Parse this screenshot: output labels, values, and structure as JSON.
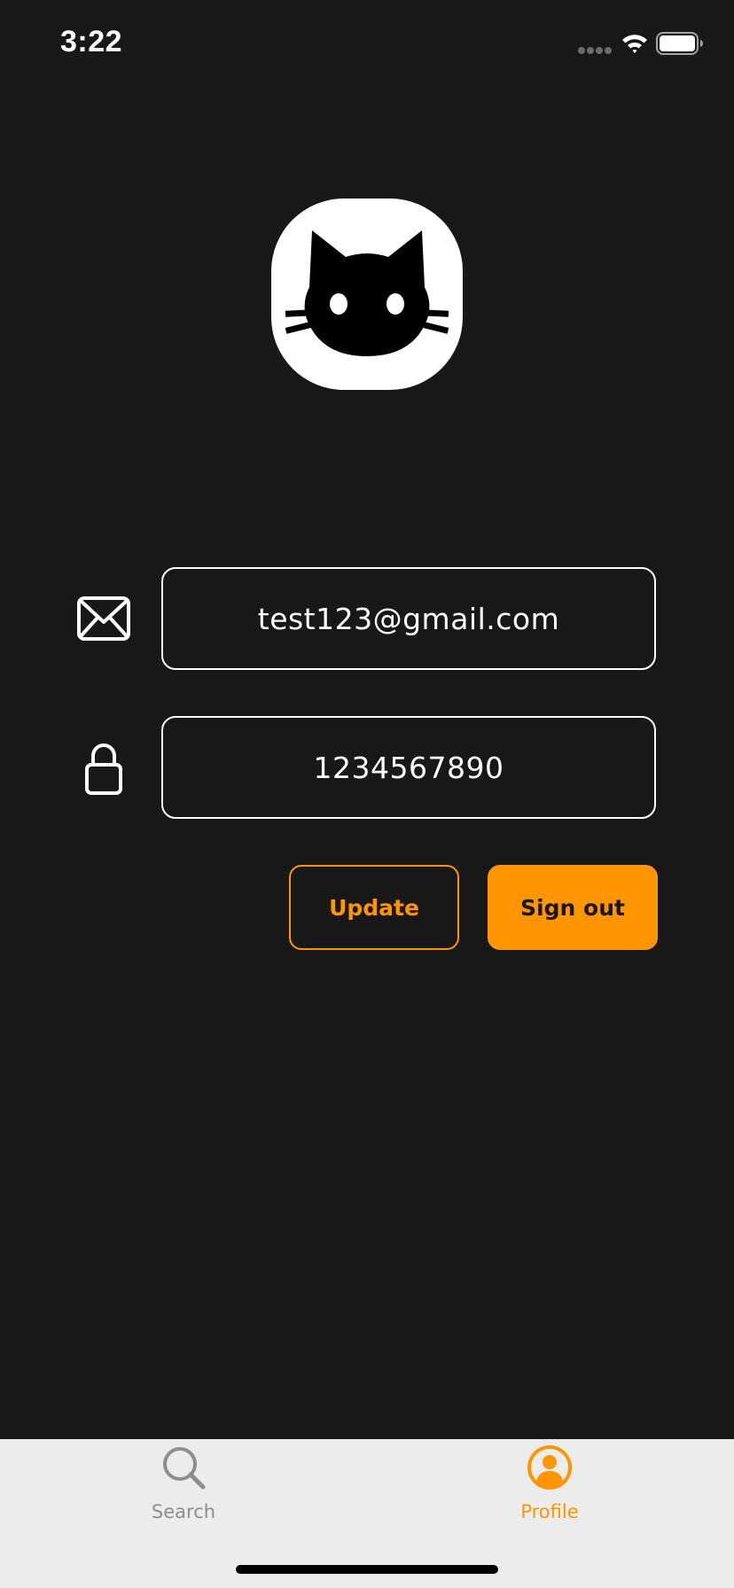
{
  "status_bar": {
    "time": "3:22",
    "icons": [
      "cellular-signal-icon",
      "wifi-icon",
      "battery-icon"
    ]
  },
  "logo": {
    "icon": "cat-icon",
    "background_color": "#ffffff"
  },
  "form": {
    "email": {
      "icon": "envelope-icon",
      "value": "test123@gmail.com"
    },
    "password": {
      "icon": "lock-icon",
      "value": "1234567890"
    }
  },
  "buttons": {
    "update_label": "Update",
    "sign_out_label": "Sign out"
  },
  "tab_bar": {
    "tabs": [
      {
        "label": "Search",
        "icon": "magnifier-icon",
        "selected": false
      },
      {
        "label": "Profile",
        "icon": "person-circle-icon",
        "selected": true
      }
    ]
  },
  "colors": {
    "background": "#181818",
    "accent": "#ff9500",
    "tab_bar_background": "#ececec",
    "inactive_tab": "#8e8e8e"
  }
}
